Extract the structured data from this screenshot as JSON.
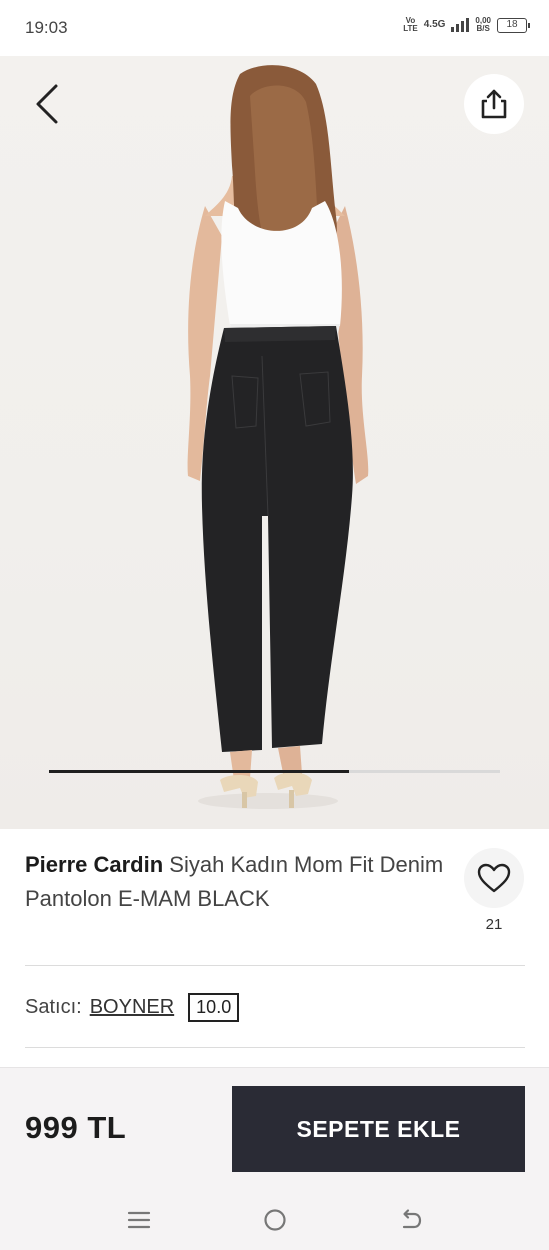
{
  "status_bar": {
    "time": "19:03",
    "volte_top": "Vo",
    "volte_bottom": "LTE",
    "network": "4.5G",
    "data_rate_top": "0,00",
    "data_rate_bottom": "B/S",
    "battery": "18"
  },
  "product": {
    "brand": "Pierre Cardin",
    "name": "Siyah Kadın Mom Fit Denim Pantolon E-MAM BLACK",
    "favorite_count": "21",
    "image_progress": 0.665
  },
  "seller": {
    "label": "Satıcı:",
    "name": "BOYNER",
    "score": "10.0"
  },
  "purchase": {
    "price": "999 TL",
    "add_to_cart_label": "SEPETE EKLE"
  },
  "icons": {
    "back": "chevron-left-icon",
    "share": "share-icon",
    "favorite": "heart-icon",
    "nav_menu": "menu-icon",
    "nav_home": "home-circle-icon",
    "nav_back": "back-arrow-icon"
  },
  "colors": {
    "primary_button": "#2a2b35",
    "image_background": "#f1efec"
  }
}
